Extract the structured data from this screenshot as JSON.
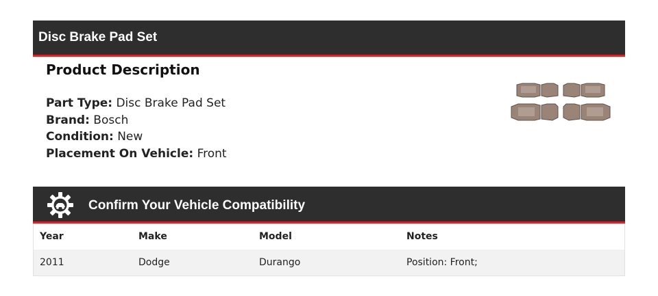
{
  "header": {
    "title": "Disc Brake Pad Set"
  },
  "description": {
    "heading": "Product Description",
    "specs": [
      {
        "label": "Part Type:",
        "value": "Disc Brake Pad Set"
      },
      {
        "label": "Brand:",
        "value": "Bosch"
      },
      {
        "label": "Condition:",
        "value": "New"
      },
      {
        "label": "Placement On Vehicle:",
        "value": "Front"
      }
    ],
    "image_icon": "brake-pads-image"
  },
  "compatibility": {
    "icon": "gear-car-icon",
    "title": "Confirm Your Vehicle Compatibility",
    "columns": [
      "Year",
      "Make",
      "Model",
      "Notes"
    ],
    "rows": [
      [
        "2011",
        "Dodge",
        "Durango",
        "Position: Front;"
      ]
    ]
  },
  "colors": {
    "bar": "#2e2e2e",
    "accent": "#d8232a",
    "row_alt": "#f2f2f2"
  }
}
